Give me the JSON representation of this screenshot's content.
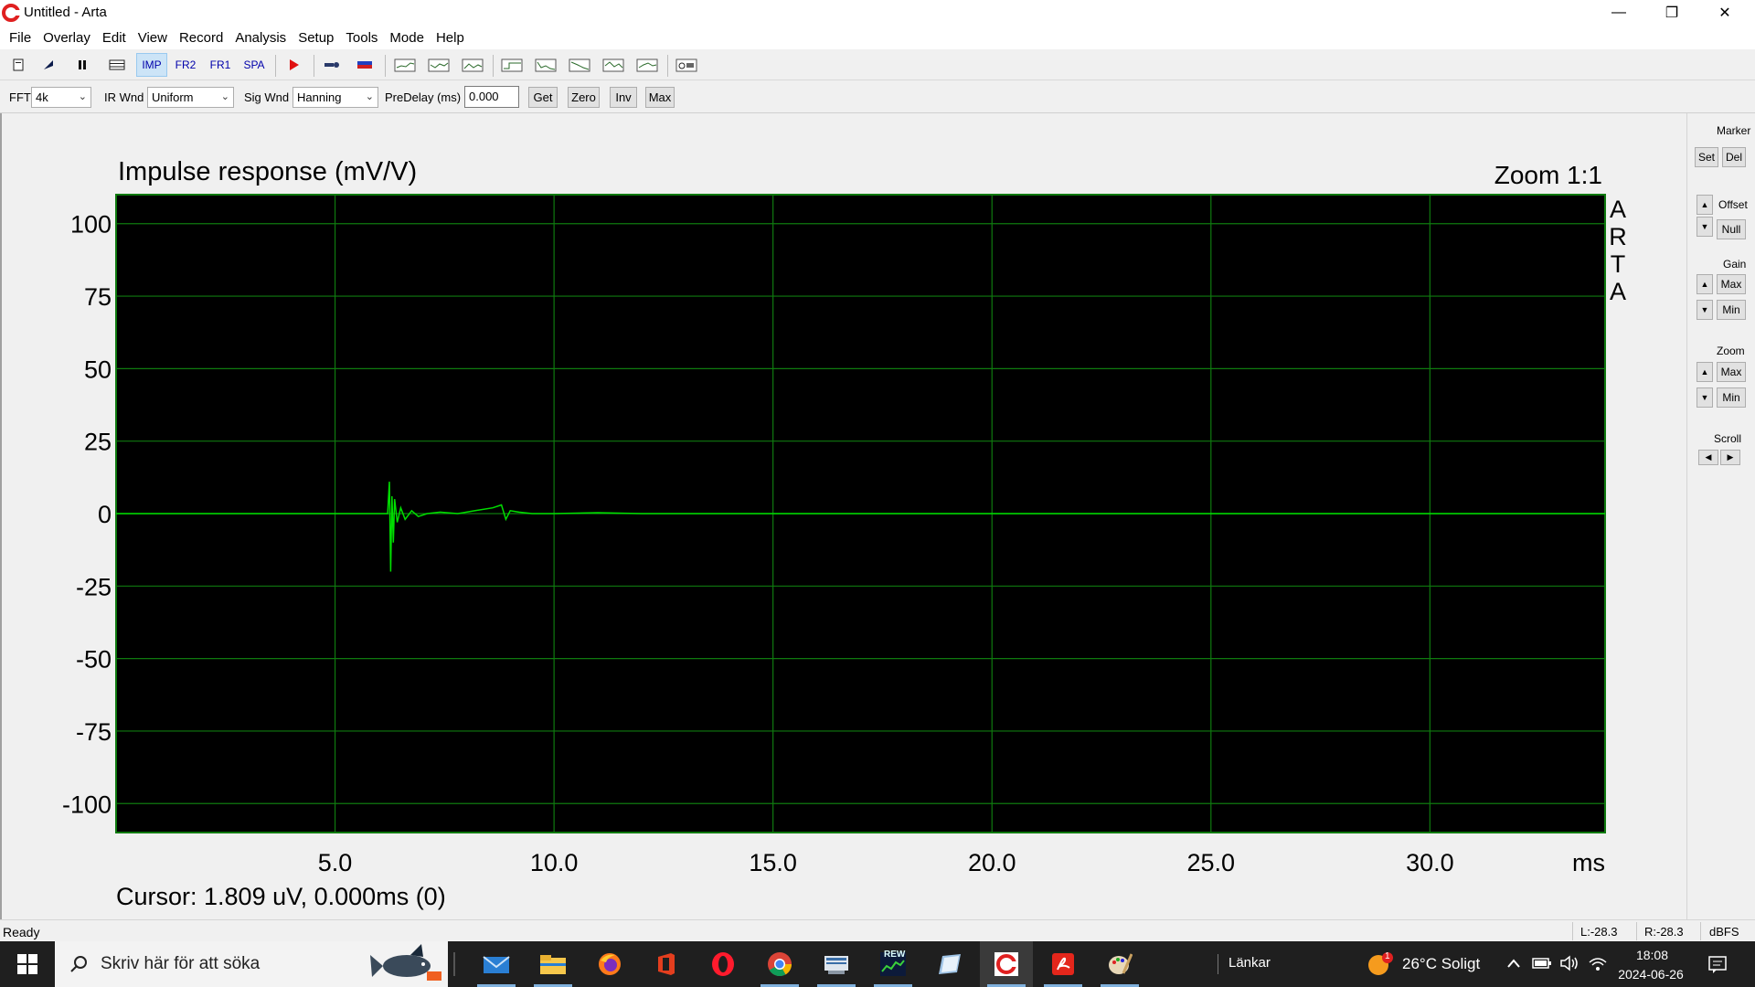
{
  "window": {
    "title": "Untitled - Arta",
    "minimize_glyph": "—",
    "maximize_glyph": "❐",
    "close_glyph": "✕"
  },
  "menu": [
    "File",
    "Overlay",
    "Edit",
    "View",
    "Record",
    "Analysis",
    "Setup",
    "Tools",
    "Mode",
    "Help"
  ],
  "toolbar": {
    "mode_buttons": [
      "IMP",
      "FR2",
      "FR1",
      "SPA"
    ],
    "active_mode": "IMP"
  },
  "settings_bar": {
    "fft_label": "FFT",
    "fft_value": "4k",
    "ir_wnd_label": "IR Wnd",
    "ir_wnd_value": "Uniform",
    "sig_wnd_label": "Sig Wnd",
    "sig_wnd_value": "Hanning",
    "predelay_label": "PreDelay (ms)",
    "predelay_value": "0.000",
    "buttons": [
      "Get",
      "Zero",
      "Inv",
      "Max"
    ]
  },
  "plot": {
    "title": "Impulse response (mV/V)",
    "zoom": "Zoom 1:1",
    "brand_letters": [
      "A",
      "R",
      "T",
      "A"
    ],
    "cursor": "Cursor: 1.809 uV, 0.000ms (0)",
    "colors": {
      "background": "#000000",
      "grid": "#0f7a0f",
      "trace": "#00dd00"
    }
  },
  "chart_data": {
    "type": "line",
    "title": "Impulse response (mV/V)",
    "xlabel": "ms",
    "ylabel": "",
    "x_ticks": [
      "5.0",
      "10.0",
      "15.0",
      "20.0",
      "25.0",
      "30.0"
    ],
    "y_ticks": [
      "100",
      "75",
      "50",
      "25",
      "0",
      "-25",
      "-50",
      "-75",
      "-100"
    ],
    "xlim": [
      0,
      34
    ],
    "ylim": [
      -110,
      110
    ],
    "grid": true,
    "series": [
      {
        "x": [
          0,
          6.0,
          6.2,
          6.24,
          6.27,
          6.3,
          6.33,
          6.36,
          6.42,
          6.5,
          6.6,
          6.75,
          6.9,
          7.1,
          7.4,
          7.8,
          8.2,
          8.6,
          8.8,
          8.9,
          9.0,
          9.2,
          9.5,
          10.0,
          11.0,
          12.0,
          14.0,
          16.0,
          18.0,
          20.0,
          22.0,
          24.0,
          26.0,
          28.0,
          30.0,
          32.0,
          34.0
        ],
        "y": [
          0,
          0,
          0,
          11,
          -20,
          6,
          -10,
          5,
          -3,
          2,
          -2,
          1,
          -1,
          0,
          0.5,
          0,
          1,
          2,
          3,
          -2,
          1,
          0.5,
          0,
          0,
          0.3,
          0,
          0,
          0,
          0,
          0,
          0,
          0,
          0,
          0,
          0,
          0,
          0
        ]
      }
    ]
  },
  "panel": {
    "marker_label": "Marker",
    "marker_buttons": [
      "Set",
      "Del"
    ],
    "offset_label": "Offset",
    "offset_button": "Null",
    "gain_label": "Gain",
    "gain_buttons": [
      "Max",
      "Min"
    ],
    "zoom_label": "Zoom",
    "zoom_buttons": [
      "Max",
      "Min"
    ],
    "scroll_label": "Scroll"
  },
  "status": {
    "ready": "Ready",
    "left_level": "L:-28.3",
    "right_level": "R:-28.3",
    "unit": "dBFS"
  },
  "taskbar": {
    "search_placeholder": "Skriv här för att söka",
    "links": "Länkar",
    "weather": "26°C  Soligt",
    "weather_badge": "1",
    "time": "18:08",
    "date": "2024-06-26",
    "rew_label": "REW"
  }
}
